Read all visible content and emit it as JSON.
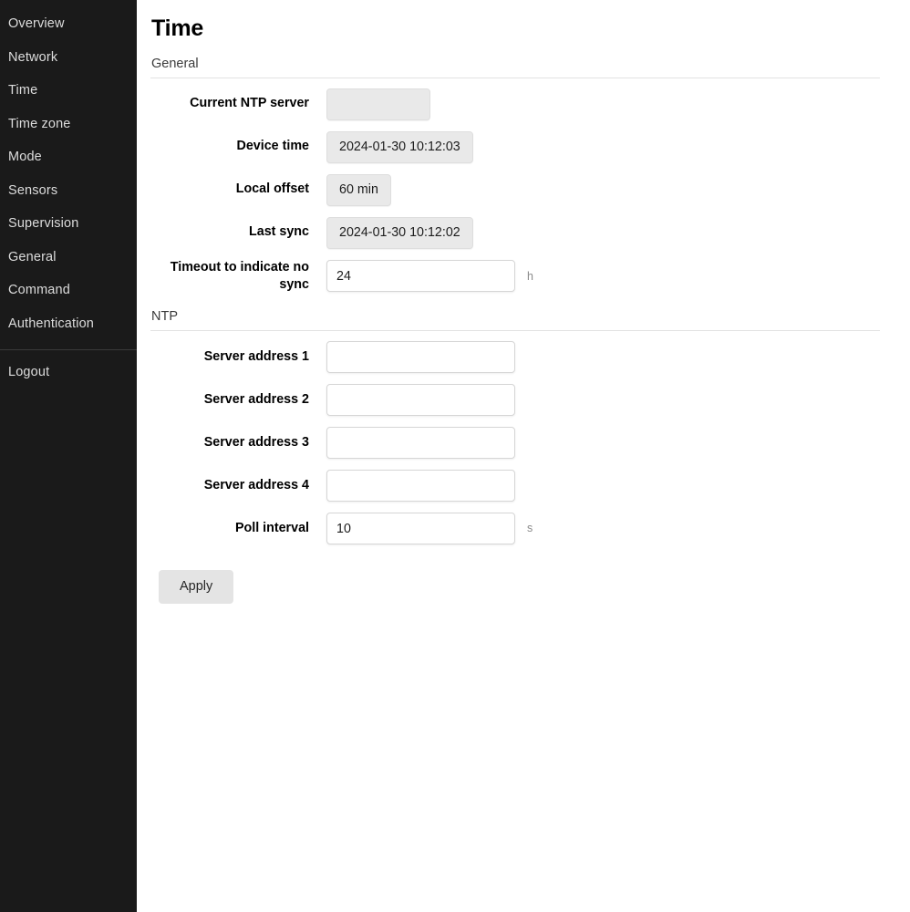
{
  "sidebar": {
    "items": [
      {
        "label": "Overview",
        "name": "overview"
      },
      {
        "label": "Network",
        "name": "network"
      },
      {
        "label": "Time",
        "name": "time"
      },
      {
        "label": "Time zone",
        "name": "time-zone"
      },
      {
        "label": "Mode",
        "name": "mode"
      },
      {
        "label": "Sensors",
        "name": "sensors"
      },
      {
        "label": "Supervision",
        "name": "supervision"
      },
      {
        "label": "General",
        "name": "general"
      },
      {
        "label": "Command",
        "name": "command"
      },
      {
        "label": "Authentication",
        "name": "authentication"
      }
    ],
    "logout_label": "Logout"
  },
  "page": {
    "title": "Time"
  },
  "sections": {
    "general": {
      "heading": "General",
      "current_ntp_server": {
        "label": "Current NTP server",
        "value": ""
      },
      "device_time": {
        "label": "Device time",
        "value": "2024-01-30 10:12:03"
      },
      "local_offset": {
        "label": "Local offset",
        "value": "60 min"
      },
      "last_sync": {
        "label": "Last sync",
        "value": "2024-01-30 10:12:02"
      },
      "timeout_no_sync": {
        "label": "Timeout to indicate no sync",
        "value": "24",
        "unit": "h",
        "placeholder": ""
      }
    },
    "ntp": {
      "heading": "NTP",
      "server_address_1": {
        "label": "Server address 1",
        "value": "",
        "placeholder": ""
      },
      "server_address_2": {
        "label": "Server address 2",
        "value": "",
        "placeholder": ""
      },
      "server_address_3": {
        "label": "Server address 3",
        "value": "",
        "placeholder": ""
      },
      "server_address_4": {
        "label": "Server address 4",
        "value": "",
        "placeholder": ""
      },
      "poll_interval": {
        "label": "Poll interval",
        "value": "10",
        "unit": "s",
        "placeholder": ""
      }
    }
  },
  "actions": {
    "apply_label": "Apply"
  },
  "colors": {
    "sidebar_background": "#1a1a1a",
    "sidebar_text": "#dcdcdc",
    "page_background": "#ffffff",
    "readonly_field": "#e9e9e9",
    "button": "#e4e4e4"
  }
}
